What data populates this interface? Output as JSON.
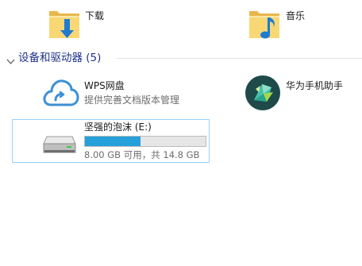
{
  "folders": [
    {
      "name": "下载",
      "icon": "downloads-folder-icon"
    },
    {
      "name": "音乐",
      "icon": "music-folder-icon"
    }
  ],
  "group": {
    "title": "设备和驱动器 (5)",
    "chevron": "chevron-down-icon"
  },
  "devices": [
    {
      "name": "WPS网盘",
      "sub": "提供完善文档版本管理",
      "icon": "cloud-icon"
    },
    {
      "name": "华为手机助手",
      "icon": "huawei-hisuite-icon"
    }
  ],
  "drive": {
    "name": "坚强的泡沫 (E:)",
    "usage_text": "8.00 GB 可用，共 14.8 GB",
    "used_fraction": 0.46,
    "icon": "usb-drive-icon",
    "bar_color": "#26a0da"
  },
  "colors": {
    "group_title": "#1e3287",
    "selection_border": "#99d1ff",
    "folder_yellow": "#f8d775",
    "accent_blue": "#1e7bd1"
  }
}
